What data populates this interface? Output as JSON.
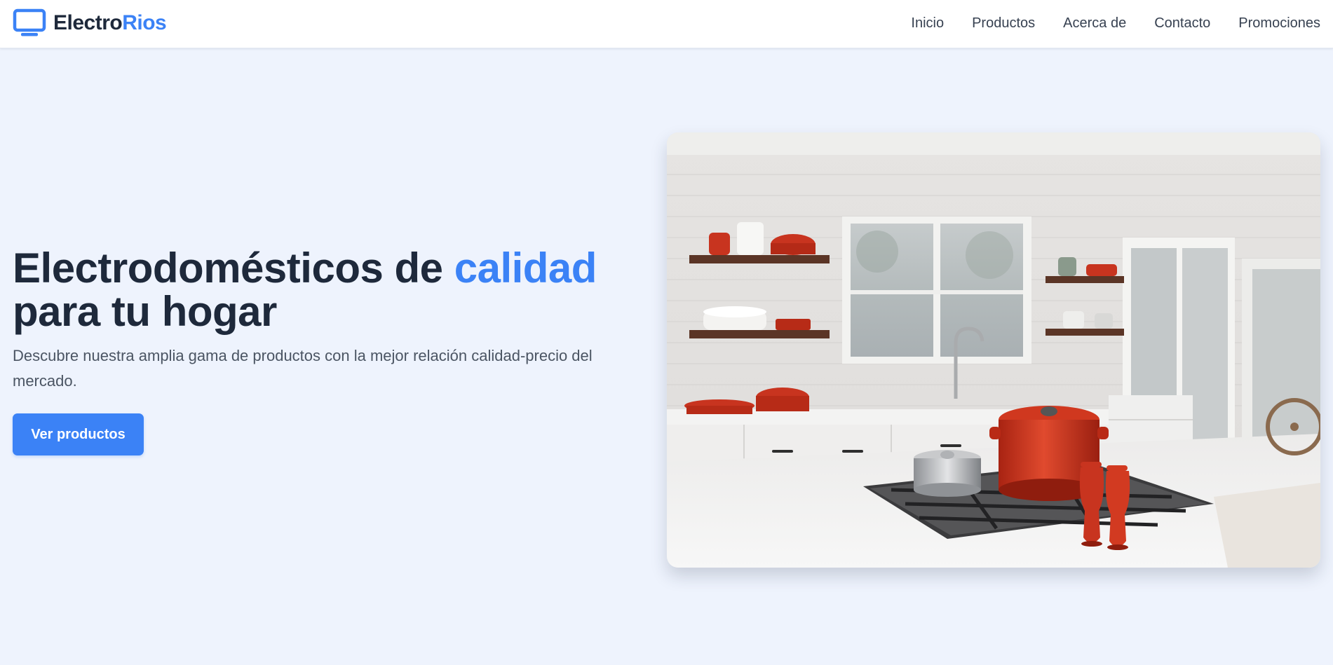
{
  "header": {
    "brand_main": "Electro",
    "brand_accent": "Rios",
    "logo_icon": "monitor-icon",
    "nav": [
      {
        "label": "Inicio"
      },
      {
        "label": "Productos"
      },
      {
        "label": "Acerca de"
      },
      {
        "label": "Contacto"
      },
      {
        "label": "Promociones"
      }
    ]
  },
  "hero": {
    "title_part1": "Electrodomésticos de ",
    "title_accent": "calidad",
    "title_part2": "para tu hogar",
    "description": "Descubre nuestra amplia gama de productos con la mejor relación calidad-precio del mercado.",
    "cta_label": "Ver productos",
    "image_subject": "kitchen-photo"
  },
  "colors": {
    "accent": "#3b82f6",
    "text_dark": "#1e293b",
    "text_muted": "#4b5563",
    "page_background": "#eef3fd",
    "header_background": "#ffffff",
    "cookware_red": "#c8341f"
  }
}
